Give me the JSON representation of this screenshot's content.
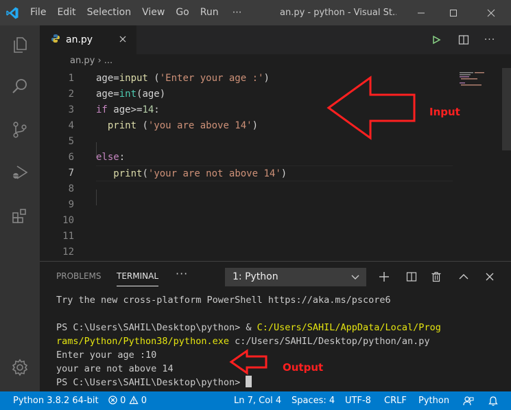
{
  "window": {
    "title": "an.py - python - Visual St...",
    "menu": [
      "File",
      "Edit",
      "Selection",
      "View",
      "Go",
      "Run",
      "⋯"
    ]
  },
  "editor": {
    "tab_label": "an.py",
    "breadcrumb": "an.py",
    "breadcrumb_more": "...",
    "line_numbers": [
      "1",
      "2",
      "3",
      "4",
      "5",
      "6",
      "7",
      "8",
      "9",
      "10",
      "11",
      "12"
    ],
    "code": {
      "l1": {
        "a": "age=",
        "b": "input",
        "c": " (",
        "d": "'Enter your age :'",
        "e": ")"
      },
      "l2": {
        "a": "age=",
        "b": "int",
        "c": "(age)"
      },
      "l3": {
        "a": "if",
        "b": " age>=",
        "c": "14",
        "d": ":"
      },
      "l4": {
        "a": "  ",
        "b": "print",
        "c": " (",
        "d": "'you are above 14'",
        "e": ")"
      },
      "l6": {
        "a": "else",
        "b": ":"
      },
      "l7": {
        "a": "   ",
        "b": "print",
        "c": "(",
        "d": "'your are not above 14'",
        "e": ")"
      }
    }
  },
  "annotations": {
    "input_label": "Input",
    "output_label": "Output"
  },
  "panel": {
    "tabs": [
      "PROBLEMS",
      "TERMINAL"
    ],
    "more": "···",
    "terminal_select": "1: Python",
    "lines": {
      "t1": "Try the new cross-platform PowerShell https://aka.ms/pscore6",
      "t3a": "PS C:\\Users\\SAHIL\\Desktop\\python> & ",
      "t3b": "C:/Users/SAHIL/AppData/Local/Prog",
      "t4a": "rams/Python/Python38/python.exe",
      "t4b": " c:/Users/SAHIL/Desktop/python/an.py",
      "t5": "Enter your age :10",
      "t6": "your are not above 14",
      "t7": "PS C:\\Users\\SAHIL\\Desktop\\python> "
    }
  },
  "statusbar": {
    "interpreter": "Python 3.8.2 64-bit",
    "errors": "0",
    "warnings": "0",
    "position": "Ln 7, Col 4",
    "spaces": "Spaces: 4",
    "encoding": "UTF-8",
    "eol": "CRLF",
    "language": "Python"
  },
  "colors": {
    "accent": "#007acc",
    "annotation": "#ff2020"
  }
}
